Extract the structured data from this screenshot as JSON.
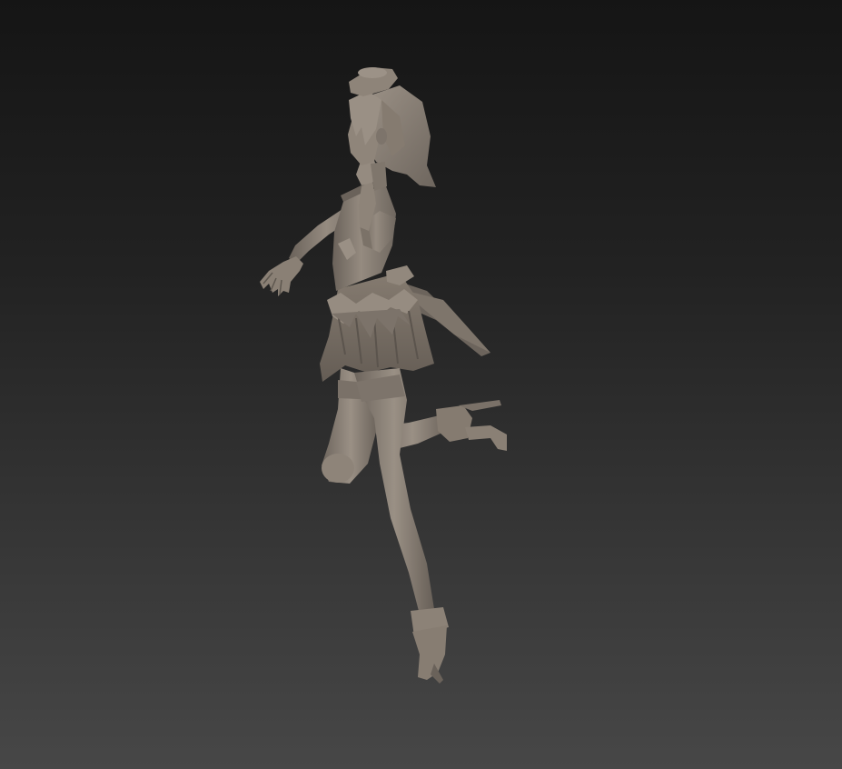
{
  "viewport": {
    "background_top": "#151515",
    "background_bottom": "#474747"
  },
  "model": {
    "subject": "sculpted-figure",
    "material_color": "#8b8177",
    "shadow_color": "#5c554e",
    "highlight_color": "#a89e93",
    "dark_color": "#3e3a35"
  }
}
